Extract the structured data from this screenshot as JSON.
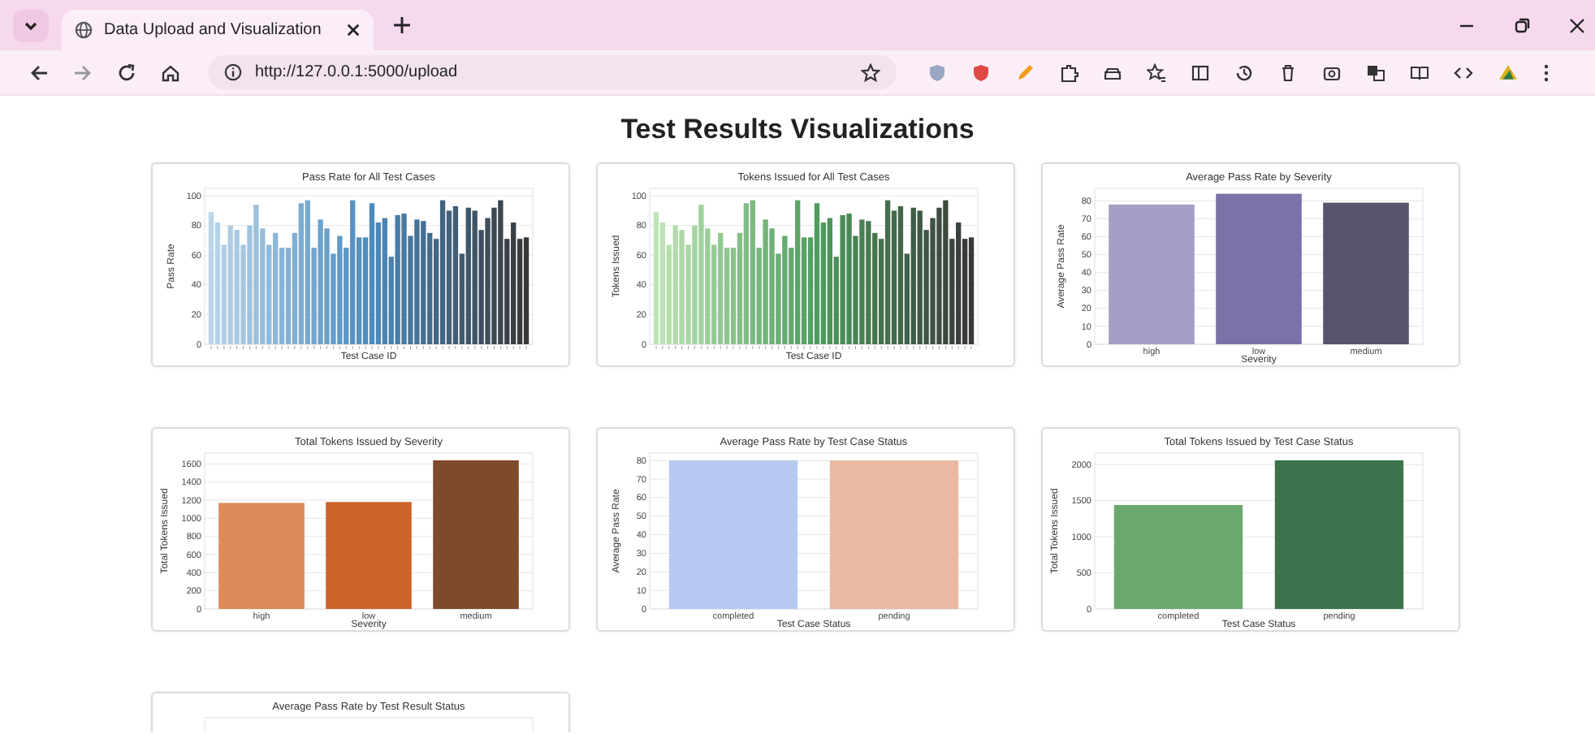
{
  "browser": {
    "tab": {
      "title": "Data Upload and Visualization",
      "selected": true
    },
    "address": "http://127.0.0.1:5000/upload"
  },
  "page": {
    "heading": "Test Results Visualizations",
    "charts": [
      {
        "chart_data": {
          "type": "bar",
          "title": "Pass Rate for All Test Cases",
          "xlabel": "Test Case ID",
          "ylabel": "Pass Rate",
          "yticks": [
            0,
            20,
            40,
            60,
            80,
            100
          ],
          "ylim": [
            0,
            105
          ],
          "grid": true,
          "series": [
            {
              "values": [
                89,
                82,
                67,
                80,
                77,
                67,
                80,
                94,
                78,
                67,
                75,
                65,
                65,
                75,
                95,
                97,
                65,
                84,
                78,
                61,
                73,
                65,
                97,
                72,
                72,
                95,
                82,
                85,
                59,
                87,
                88,
                73,
                84,
                83,
                75,
                71,
                97,
                90,
                93,
                61,
                92,
                90,
                77,
                85,
                92,
                97,
                71,
                82,
                71,
                72
              ],
              "colors": [
                "#b9d5ea",
                "#b5d2e8",
                "#b0cfe6",
                "#accce5",
                "#a7c9e3",
                "#a3c6e1",
                "#9fc3df",
                "#9ac0dd",
                "#96bddc",
                "#91bada",
                "#8db7d8",
                "#89b4d6",
                "#84b1d4",
                "#80afd3",
                "#7bacd1",
                "#77a9cf",
                "#73a6cd",
                "#6ea3cb",
                "#6aa0ca",
                "#659dc8",
                "#619ac6",
                "#5d97c4",
                "#5894c2",
                "#5491c1",
                "#4f8ebf",
                "#4b8bbd",
                "#4a88b7",
                "#4984b2",
                "#4981ac",
                "#487da7",
                "#477aa1",
                "#46769c",
                "#457396",
                "#456f91",
                "#446c8b",
                "#436886",
                "#426580",
                "#42617b",
                "#415e75",
                "#405b6f",
                "#3f576a",
                "#3e5464",
                "#3e505f",
                "#3d4d59",
                "#3c4954",
                "#3b464e",
                "#3a4249",
                "#3a3f43",
                "#393b3e",
                "#383838"
              ]
            }
          ]
        }
      },
      {
        "chart_data": {
          "type": "bar",
          "title": "Tokens Issued for All Test Cases",
          "xlabel": "Test Case ID",
          "ylabel": "Tokens Issued",
          "yticks": [
            0,
            20,
            40,
            60,
            80,
            100
          ],
          "ylim": [
            0,
            105
          ],
          "grid": true,
          "series": [
            {
              "values": [
                89,
                82,
                67,
                80,
                77,
                67,
                80,
                94,
                78,
                67,
                75,
                65,
                65,
                75,
                95,
                97,
                65,
                84,
                78,
                61,
                73,
                65,
                97,
                72,
                72,
                95,
                82,
                85,
                59,
                87,
                88,
                73,
                84,
                83,
                75,
                71,
                97,
                90,
                93,
                61,
                92,
                90,
                77,
                85,
                92,
                97,
                71,
                82,
                71,
                72
              ],
              "colors": [
                "#bfe5b5",
                "#bbe2b2",
                "#b6dfae",
                "#b2dcab",
                "#add9a7",
                "#a9d6a4",
                "#a4d3a0",
                "#a0d19d",
                "#9bce99",
                "#97cb96",
                "#92c892",
                "#8ec58f",
                "#89c28b",
                "#85bf88",
                "#80bc84",
                "#7cb981",
                "#77b67d",
                "#73b37a",
                "#6eb076",
                "#6aae73",
                "#65ab6f",
                "#61a86c",
                "#5ca568",
                "#58a265",
                "#539f61",
                "#4f9c5e",
                "#4e985c",
                "#4d945b",
                "#4c8f59",
                "#4b8b58",
                "#4a8756",
                "#498355",
                "#487f53",
                "#477b51",
                "#467650",
                "#45724e",
                "#446e4d",
                "#436a4b",
                "#436649",
                "#426248",
                "#415d46",
                "#405945",
                "#3f5543",
                "#3e5142",
                "#3d4d40",
                "#3c493e",
                "#3b443d",
                "#3a403b",
                "#393c3a",
                "#383838"
              ]
            }
          ]
        }
      },
      {
        "chart_data": {
          "type": "bar",
          "title": "Average Pass Rate by Severity",
          "xlabel": "Severity",
          "ylabel": "Average Pass Rate",
          "categories": [
            "high",
            "low",
            "medium"
          ],
          "yticks": [
            0,
            10,
            20,
            30,
            40,
            50,
            60,
            70,
            80
          ],
          "ylim": [
            0,
            87
          ],
          "grid": true,
          "series": [
            {
              "values": [
                78,
                84,
                79
              ],
              "colors": [
                "#a39fc6",
                "#7b73a8",
                "#57546e"
              ]
            }
          ]
        }
      },
      {
        "chart_data": {
          "type": "bar",
          "title": "Total Tokens Issued by Severity",
          "xlabel": "Severity",
          "ylabel": "Total Tokens Issued",
          "categories": [
            "high",
            "low",
            "medium"
          ],
          "yticks": [
            0,
            200,
            400,
            600,
            800,
            1000,
            1200,
            1400,
            1600
          ],
          "ylim": [
            0,
            1720
          ],
          "grid": true,
          "series": [
            {
              "values": [
                1170,
                1180,
                1640
              ],
              "colors": [
                "#dc8c5a",
                "#cb6428",
                "#7f4a2b"
              ]
            }
          ]
        }
      },
      {
        "chart_data": {
          "type": "bar",
          "title": "Average Pass Rate by Test Case Status",
          "xlabel": "Test Case Status",
          "ylabel": "Average Pass Rate",
          "categories": [
            "completed",
            "pending"
          ],
          "yticks": [
            0,
            10,
            20,
            30,
            40,
            50,
            60,
            70,
            80
          ],
          "ylim": [
            0,
            84
          ],
          "grid": true,
          "series": [
            {
              "values": [
                80,
                80
              ],
              "colors": [
                "#b5c9f2",
                "#ebb9a1"
              ]
            }
          ]
        }
      },
      {
        "chart_data": {
          "type": "bar",
          "title": "Total Tokens Issued by Test Case Status",
          "xlabel": "Test Case Status",
          "ylabel": "Total Tokens Issued",
          "categories": [
            "completed",
            "pending"
          ],
          "yticks": [
            0,
            500,
            1000,
            1500,
            2000
          ],
          "ylim": [
            0,
            2160
          ],
          "grid": true,
          "series": [
            {
              "values": [
                1440,
                2060
              ],
              "colors": [
                "#6aa96d",
                "#3d734c"
              ]
            }
          ]
        }
      }
    ],
    "partial_chart": {
      "title": "Average Pass Rate by Test Result Status"
    }
  }
}
